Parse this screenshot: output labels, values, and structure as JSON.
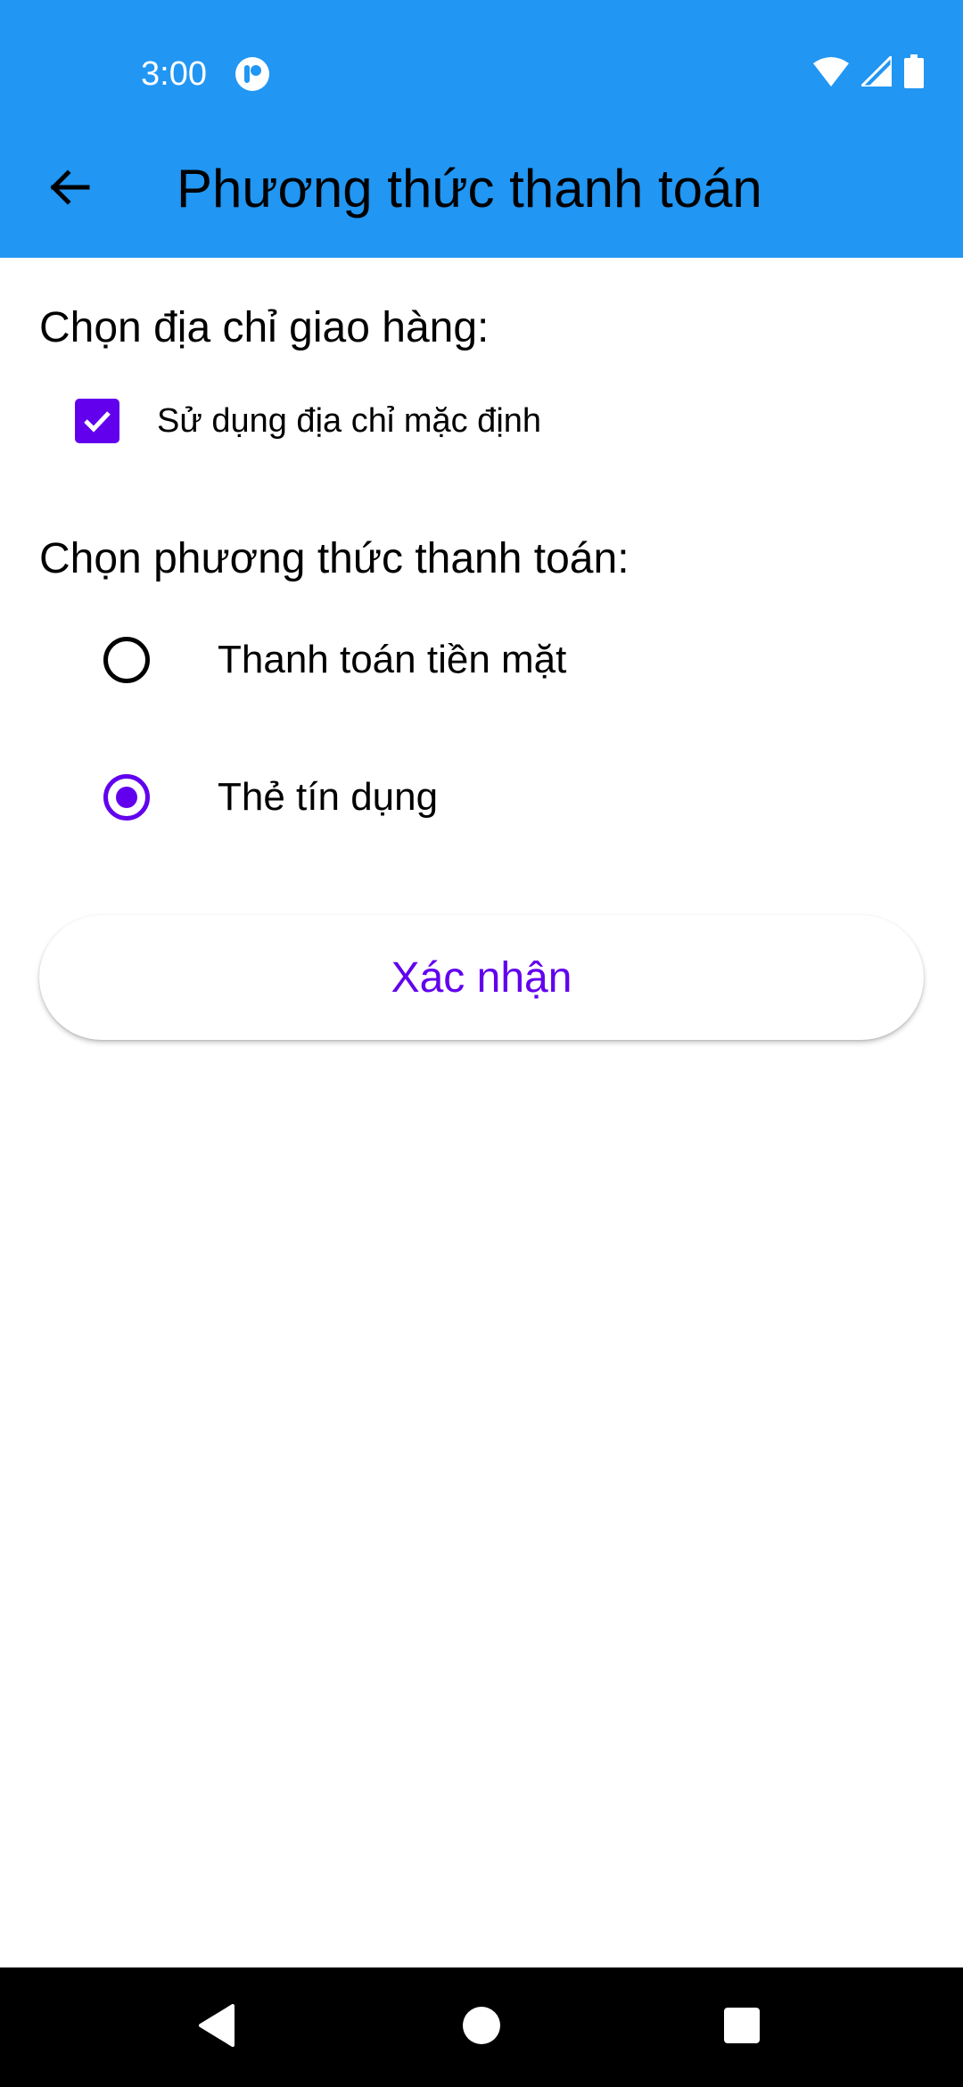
{
  "status_bar": {
    "time": "3:00",
    "icons": [
      "app-notification-icon",
      "wifi-icon",
      "cell-signal-icon",
      "battery-icon"
    ]
  },
  "app_bar": {
    "title": "Phương thức thanh toán",
    "back_icon": "arrow-back-icon",
    "background_color": "#2196F3"
  },
  "address_section": {
    "label": "Chọn địa chỉ giao hàng:",
    "use_default": {
      "label": "Sử dụng địa chỉ mặc định",
      "checked": true
    }
  },
  "payment_section": {
    "label": "Chọn phương thức thanh toán:",
    "options": [
      {
        "label": "Thanh toán tiền mặt",
        "selected": false
      },
      {
        "label": "Thẻ tín dụng",
        "selected": true
      }
    ]
  },
  "confirm_button": {
    "label": "Xác nhận"
  },
  "nav_bar": {
    "buttons": [
      "back-triangle-icon",
      "home-circle-icon",
      "recents-square-icon"
    ]
  },
  "colors": {
    "primary": "#2196F3",
    "accent": "#6200EE"
  }
}
